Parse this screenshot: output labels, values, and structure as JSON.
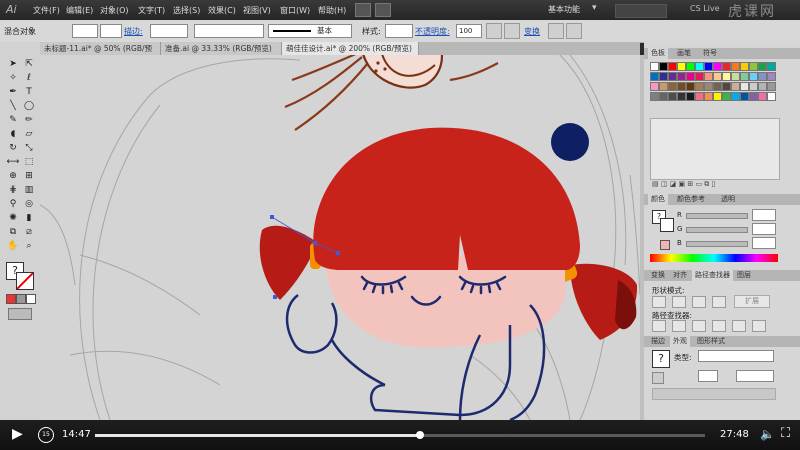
{
  "menubar": {
    "logo": "Ai",
    "items": [
      "文件(F)",
      "编辑(E)",
      "对象(O)",
      "文字(T)",
      "选择(S)",
      "效果(C)",
      "视图(V)",
      "窗口(W)",
      "帮助(H)"
    ],
    "workspace": "基本功能",
    "cs_live": "CS Live",
    "watermark": "虎课网"
  },
  "control_bar": {
    "selection_label": "混合对象",
    "stroke_label": "描边:",
    "stroke_style": "基本",
    "style_label": "样式:",
    "opacity_label": "不透明度:",
    "opacity_value": "100",
    "recolor": "变换"
  },
  "tabs": [
    {
      "label": "未标题-11.ai* @ 50% (RGB/预览)",
      "active": false
    },
    {
      "label": "准备.ai @ 33.33% (RGB/预览)",
      "active": false
    },
    {
      "label": "萌佳佳设计.ai* @ 200% (RGB/预览)",
      "active": true
    }
  ],
  "panels": {
    "swatches_tabs": [
      "色板",
      "画笔",
      "符号"
    ],
    "color_tabs": [
      "颜色",
      "颜色参考",
      "透明"
    ],
    "color_labels": [
      "R",
      "G",
      "B"
    ],
    "pathfinder_tabs": [
      "变换",
      "对齐",
      "路径查找器",
      "图层"
    ],
    "shape_modes": "形状模式:",
    "expand_btn": "扩展",
    "pathfinders": "路径查找器:",
    "graphic_tabs": [
      "描边",
      "外观",
      "图形样式"
    ],
    "type_label": "类型:"
  },
  "swatch_colors": [
    "#ffffff",
    "#000000",
    "#ff0000",
    "#ffff00",
    "#00ff00",
    "#00ffff",
    "#0000ff",
    "#ff00ff",
    "#e8262d",
    "#f47a20",
    "#fbcb0a",
    "#8dc63f",
    "#1aa34a",
    "#00a99d",
    "#0072bc",
    "#2e3192",
    "#662d91",
    "#92278f",
    "#ec008c",
    "#ed145b",
    "#f7977a",
    "#fdc68a",
    "#fff79a",
    "#c4df9b",
    "#82ca9c",
    "#6dcff6",
    "#8393ca",
    "#a186be",
    "#f49ac2",
    "#c69c6d",
    "#8c6239",
    "#754c24",
    "#603913",
    "#a67c52",
    "#998675",
    "#736357",
    "#534741",
    "#c7b299",
    "#e6e6e6",
    "#cccccc",
    "#b3b3b3",
    "#999999",
    "#808080",
    "#666666",
    "#4d4d4d",
    "#333333",
    "#1a1a1a",
    "#f26d7d",
    "#f68e56",
    "#fff200",
    "#39b54a",
    "#00aeef",
    "#0054a6",
    "#8560a8",
    "#f06eaa",
    "#ffffff"
  ],
  "player": {
    "current_time": "14:47",
    "total_time": "27:48",
    "progress": 0.532
  },
  "colors": {
    "hair": "#c8231b",
    "face": "#f2c4bd",
    "outline": "#1d2a6e",
    "dot": "#0e1f63",
    "orange": "#f39200"
  }
}
